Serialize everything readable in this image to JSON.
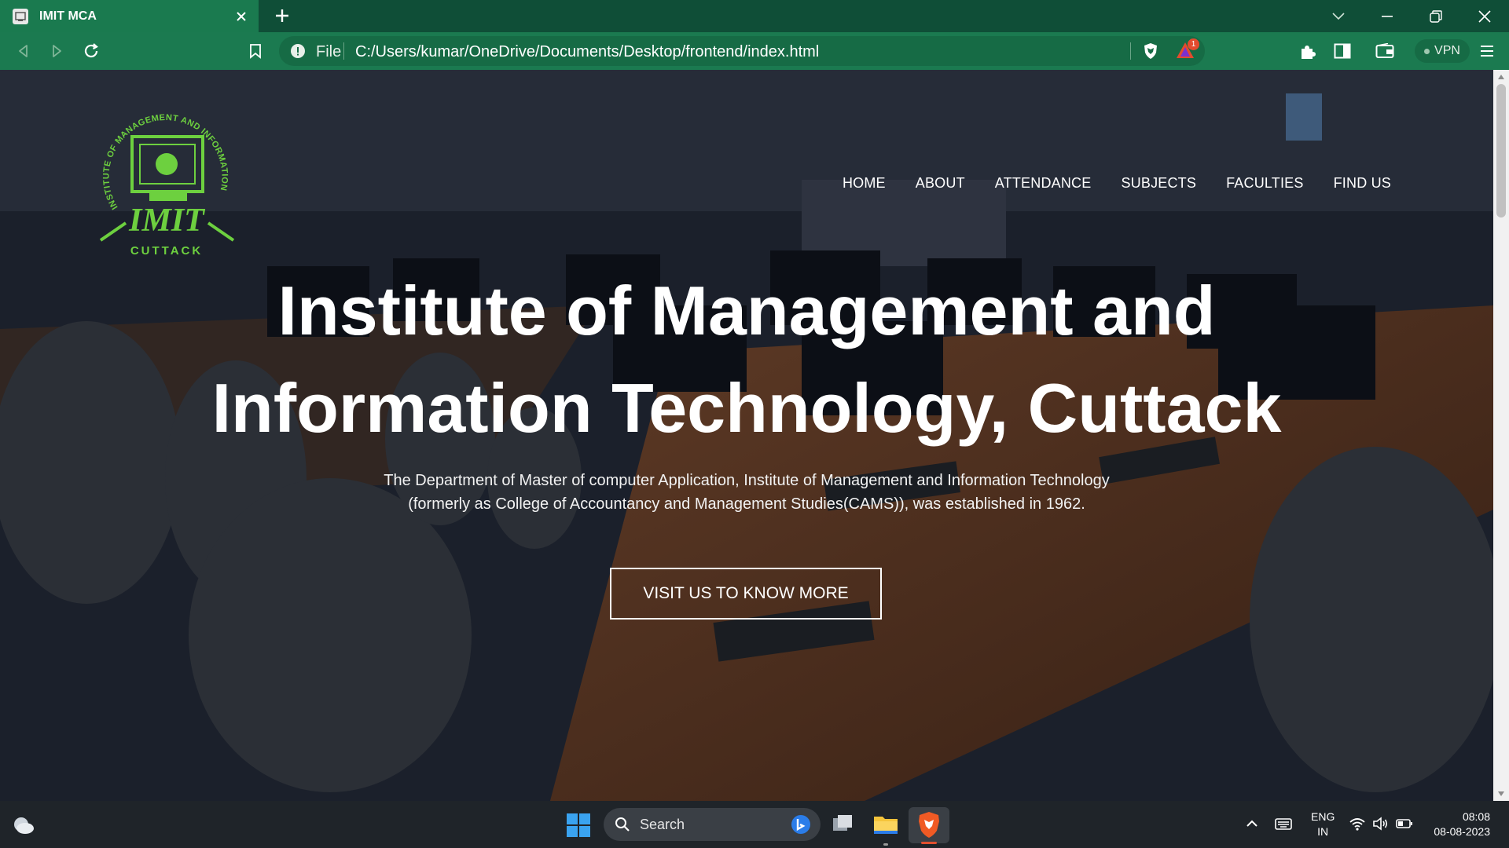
{
  "browser": {
    "tab": {
      "title": "IMIT MCA"
    },
    "omnibox": {
      "scheme_label": "File",
      "url": "C:/Users/kumar/OneDrive/Documents/Desktop/frontend/index.html"
    },
    "rewards_badge_count": "1",
    "vpn_label": "VPN",
    "accent": "#1b7a50"
  },
  "site": {
    "logo": {
      "top_text": "INSTITUTE OF MANAGEMENT AND INFORMATION TECHNOLOGY",
      "mid_text": "IMIT",
      "bottom_text": "CUTTACK"
    },
    "nav": [
      "HOME",
      "ABOUT",
      "ATTENDANCE",
      "SUBJECTS",
      "FACULTIES",
      "FIND US"
    ],
    "hero": {
      "title_line1": "Institute of Management and",
      "title_line2": "Information Technology, Cuttack",
      "subtitle_line1": "The Department of Master of computer Application, Institute of Management and Information Technology",
      "subtitle_line2": "(formerly as College of Accountancy and Management Studies(CAMS)), was established in 1962.",
      "cta": "VISIT US TO KNOW MORE"
    }
  },
  "taskbar": {
    "search_label": "Search",
    "lang_line1": "ENG",
    "lang_line2": "IN",
    "time": "08:08",
    "date": "08-08-2023"
  }
}
